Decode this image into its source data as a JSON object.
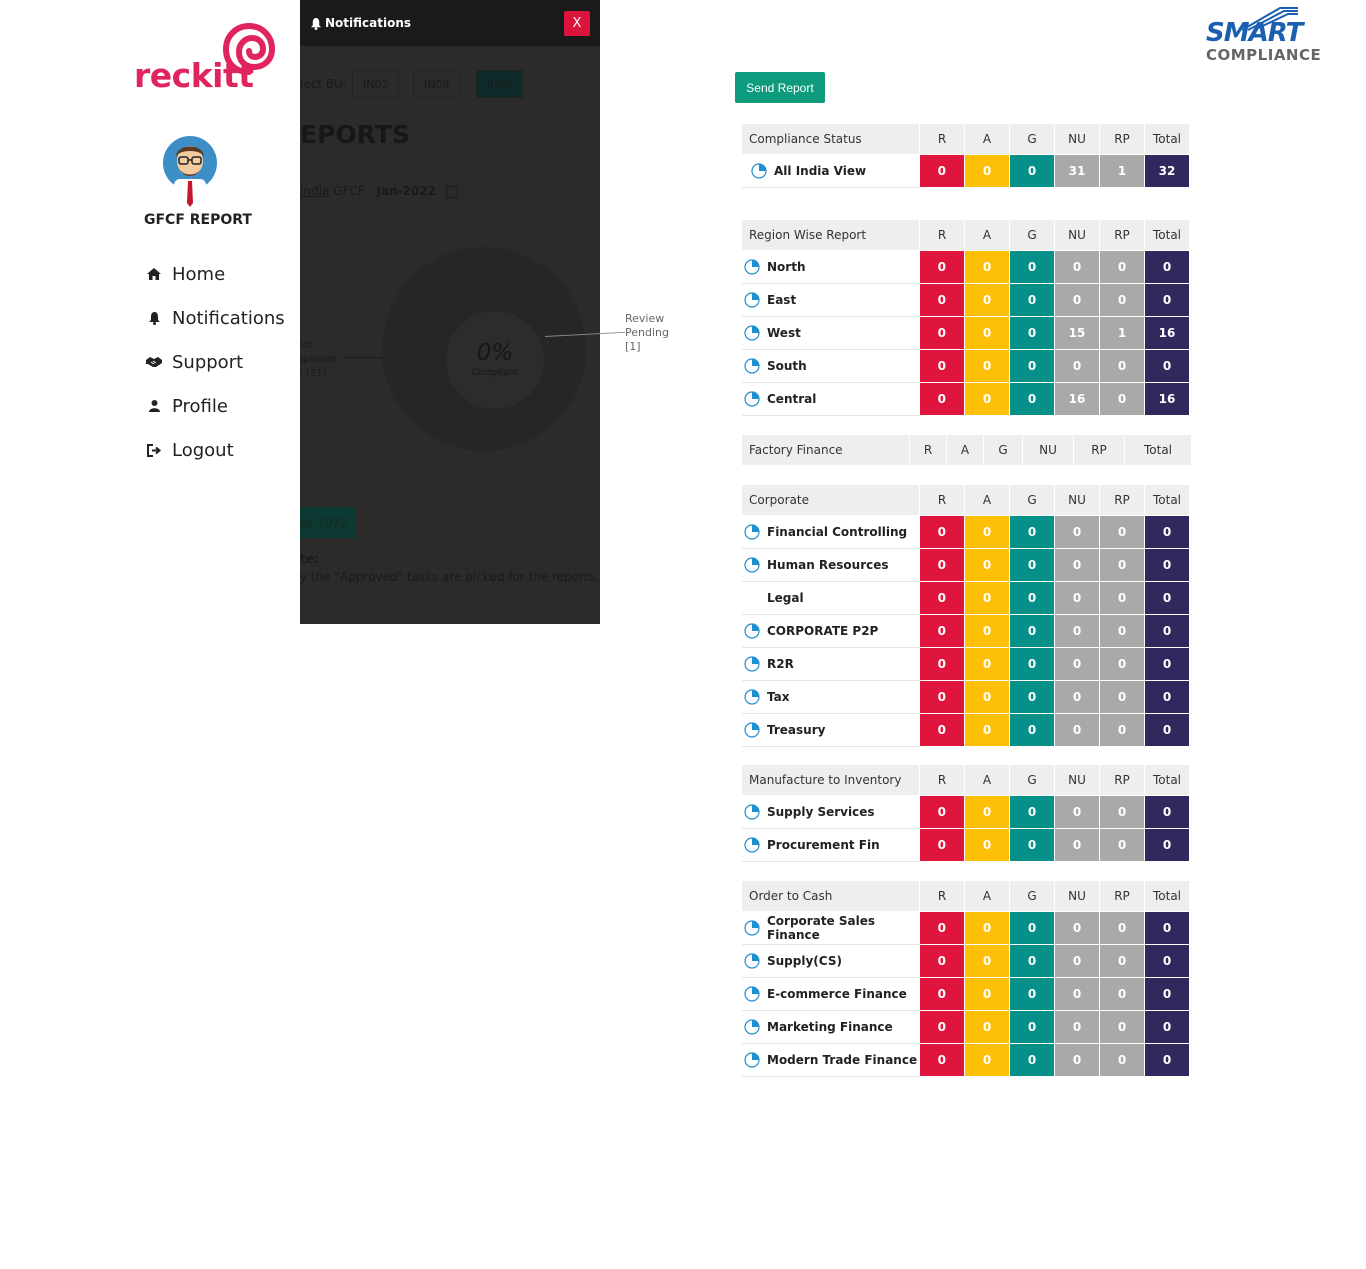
{
  "sidebar": {
    "brand": "reckitt",
    "title": "GFCF REPORT",
    "nav": [
      {
        "label": "Home",
        "icon": "home-icon"
      },
      {
        "label": "Notifications",
        "icon": "bell-icon"
      },
      {
        "label": "Support",
        "icon": "handshake-icon"
      },
      {
        "label": "Profile",
        "icon": "user-icon"
      },
      {
        "label": "Logout",
        "icon": "logout-icon"
      }
    ]
  },
  "notifications": {
    "title": "Notifications",
    "close_label": "X"
  },
  "background_page": {
    "bu_label": "lect BU:",
    "bu_options": [
      "IN02",
      "IN09",
      "IN06"
    ],
    "reports_title": "EPORTS",
    "gfcf_link": "India",
    "gfcf_label": " GFCF : ",
    "gfcf_period": "Jan-2022",
    "donut_percent": "0%",
    "donut_sub": "Compliant",
    "not_uploaded": [
      "lot",
      "Jploade",
      "l [31]"
    ],
    "period_button": "eb-2022",
    "note_label": "te:",
    "note_text": "y the \"Approved\" tasks are picked for the reports."
  },
  "review_pending": [
    "Review",
    "Pending",
    "[1]"
  ],
  "smart_logo": {
    "word": "SMART",
    "sub": "COMPLIANCE"
  },
  "send_report_label": "Send Report",
  "columns": [
    "R",
    "A",
    "G",
    "NU",
    "RP",
    "Total"
  ],
  "tables": [
    {
      "title": "Compliance Status",
      "rows": [
        {
          "name": "All India View",
          "icon": true,
          "values": [
            "0",
            "0",
            "0",
            "31",
            "1",
            "32"
          ]
        }
      ]
    },
    {
      "title": "Region Wise Report",
      "rows": [
        {
          "name": "North",
          "icon": true,
          "values": [
            "0",
            "0",
            "0",
            "0",
            "0",
            "0"
          ]
        },
        {
          "name": "East",
          "icon": true,
          "values": [
            "0",
            "0",
            "0",
            "0",
            "0",
            "0"
          ]
        },
        {
          "name": "West",
          "icon": true,
          "values": [
            "0",
            "0",
            "0",
            "15",
            "1",
            "16"
          ]
        },
        {
          "name": "South",
          "icon": true,
          "values": [
            "0",
            "0",
            "0",
            "0",
            "0",
            "0"
          ]
        },
        {
          "name": "Central",
          "icon": true,
          "values": [
            "0",
            "0",
            "0",
            "16",
            "0",
            "16"
          ]
        }
      ]
    },
    {
      "title": "Factory Finance",
      "rows": []
    },
    {
      "title": "Corporate",
      "rows": [
        {
          "name": "Financial Controlling",
          "icon": true,
          "values": [
            "0",
            "0",
            "0",
            "0",
            "0",
            "0"
          ]
        },
        {
          "name": "Human Resources",
          "icon": true,
          "values": [
            "0",
            "0",
            "0",
            "0",
            "0",
            "0"
          ]
        },
        {
          "name": "Legal",
          "icon": false,
          "values": [
            "0",
            "0",
            "0",
            "0",
            "0",
            "0"
          ]
        },
        {
          "name": "CORPORATE P2P",
          "icon": true,
          "values": [
            "0",
            "0",
            "0",
            "0",
            "0",
            "0"
          ]
        },
        {
          "name": "R2R",
          "icon": true,
          "values": [
            "0",
            "0",
            "0",
            "0",
            "0",
            "0"
          ]
        },
        {
          "name": "Tax",
          "icon": true,
          "values": [
            "0",
            "0",
            "0",
            "0",
            "0",
            "0"
          ]
        },
        {
          "name": "Treasury",
          "icon": true,
          "values": [
            "0",
            "0",
            "0",
            "0",
            "0",
            "0"
          ]
        }
      ]
    },
    {
      "title": "Manufacture to Inventory",
      "rows": [
        {
          "name": "Supply Services",
          "icon": true,
          "values": [
            "0",
            "0",
            "0",
            "0",
            "0",
            "0"
          ]
        },
        {
          "name": "Procurement Fin",
          "icon": true,
          "values": [
            "0",
            "0",
            "0",
            "0",
            "0",
            "0"
          ]
        }
      ]
    },
    {
      "title": "Order to Cash",
      "rows": [
        {
          "name": "Corporate Sales Finance",
          "icon": true,
          "values": [
            "0",
            "0",
            "0",
            "0",
            "0",
            "0"
          ]
        },
        {
          "name": "Supply(CS)",
          "icon": true,
          "values": [
            "0",
            "0",
            "0",
            "0",
            "0",
            "0"
          ]
        },
        {
          "name": "E-commerce Finance",
          "icon": true,
          "values": [
            "0",
            "0",
            "0",
            "0",
            "0",
            "0"
          ]
        },
        {
          "name": "Marketing Finance",
          "icon": true,
          "values": [
            "0",
            "0",
            "0",
            "0",
            "0",
            "0"
          ]
        },
        {
          "name": "Modern Trade Finance",
          "icon": true,
          "values": [
            "0",
            "0",
            "0",
            "0",
            "0",
            "0"
          ]
        }
      ]
    }
  ],
  "colors": {
    "r": "#e0153d",
    "a": "#fdc007",
    "g": "#05918a",
    "nu": "#a9a9a9",
    "rp": "#a9a9a9",
    "total": "#32285d",
    "send_button": "#0d9a7d",
    "brand": "#e0245e"
  }
}
